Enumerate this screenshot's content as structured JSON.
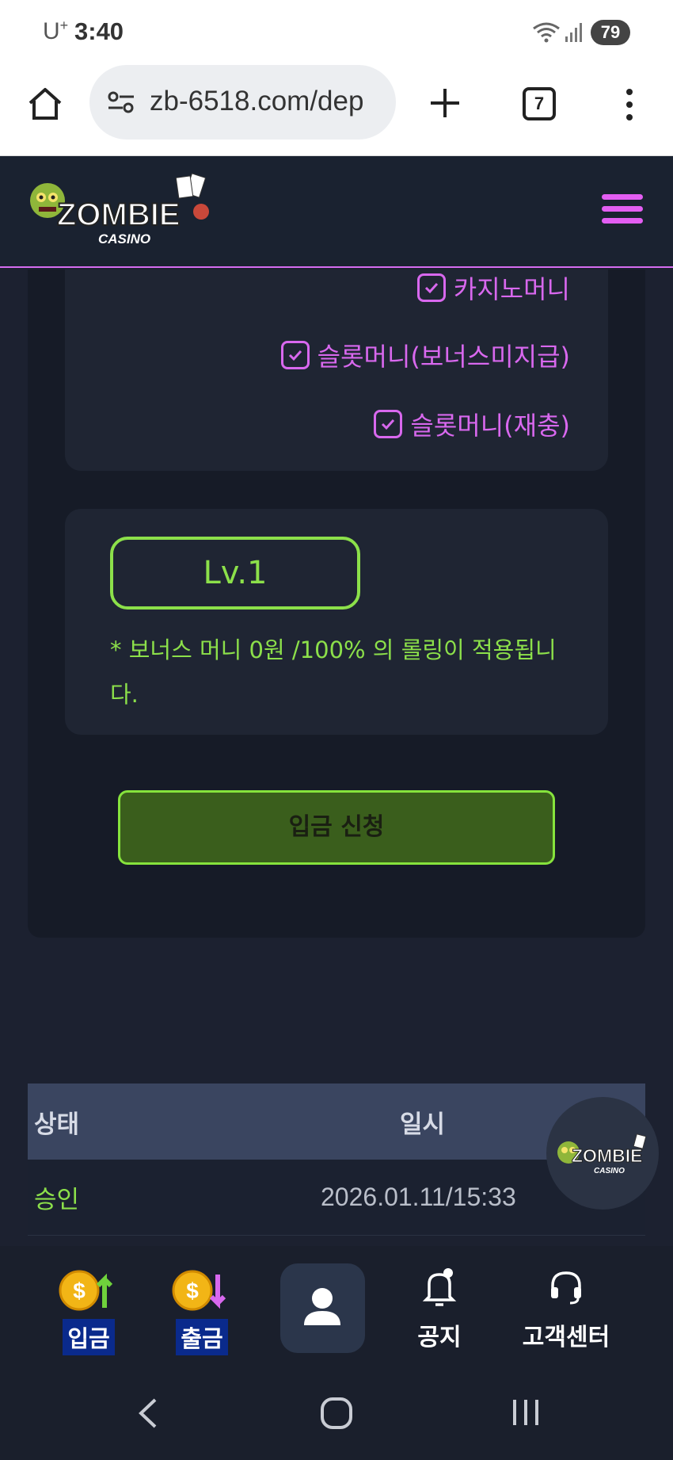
{
  "status_bar": {
    "carrier": "U",
    "carrier_sup": "+",
    "time": "3:40",
    "battery": "79"
  },
  "browser": {
    "url": "zb-6518.com/dep",
    "tab_count": "7"
  },
  "header": {
    "logo_text": "ZOMBIE",
    "logo_subtext": "CASINO",
    "accent_color": "#e35ef2"
  },
  "checks": [
    {
      "label": "카지노머니"
    },
    {
      "label": "슬롯머니(보너스미지급)"
    },
    {
      "label": "슬롯머니(재충)"
    }
  ],
  "level": {
    "badge": "Lv.1",
    "note": "* 보너스 머니 0원 /100% 의 롤링이 적용됩니다."
  },
  "deposit_button": "입금 신청",
  "history": {
    "headers": {
      "status": "상태",
      "date": "일시"
    },
    "rows": [
      {
        "status": "승인",
        "date": "2026.01.11/15:33"
      }
    ]
  },
  "bottom_nav": {
    "deposit": "입금",
    "withdraw": "출금",
    "notice": "공지",
    "support": "고객센터"
  },
  "colors": {
    "green": "#8ce04a",
    "pink": "#d868ee",
    "dark": "#1c2130"
  }
}
